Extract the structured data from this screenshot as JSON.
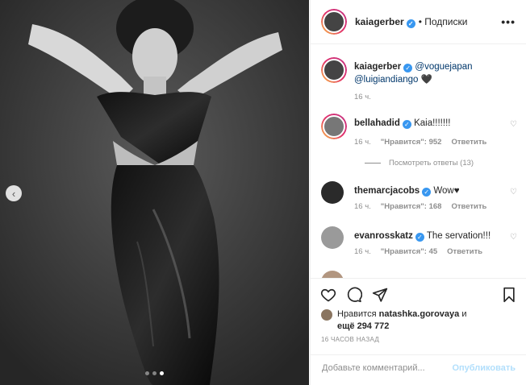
{
  "post": {
    "username": "kaiagerber",
    "follow_dot": "•",
    "follow_label": "Подписки",
    "more": "•••",
    "slide_prev": "‹"
  },
  "caption": {
    "username": "kaiagerber",
    "mention1": "@voguejapan",
    "mention2": "@luigiandiango",
    "emoji": "🖤",
    "time": "16 ч."
  },
  "comments": [
    {
      "username": "bellahadid",
      "text": "Kaia!!!!!!!",
      "time": "16 ч.",
      "likes": "\"Нравится\": 952",
      "reply": "Ответить"
    },
    {
      "username": "themarcjacobs",
      "text": "Wow♥",
      "time": "16 ч.",
      "likes": "\"Нравится\": 168",
      "reply": "Ответить"
    },
    {
      "username": "evanrosskatz",
      "text": "The servation!!!",
      "time": "16 ч.",
      "likes": "\"Нравится\": 45",
      "reply": "Ответить"
    }
  ],
  "view_replies": "Посмотреть ответы (13)",
  "likes": {
    "prefix": "Нравится",
    "user": "natashka.gorovaya",
    "suffix": "и",
    "others": "ещё 294 772"
  },
  "timestamp": "16 ЧАСОВ НАЗАД",
  "add_comment": {
    "placeholder": "Добавьте комментарий...",
    "button": "Опубликовать"
  },
  "colors": {
    "accent": "#3897f0",
    "link": "#00376b",
    "muted": "#8e8e8e"
  }
}
